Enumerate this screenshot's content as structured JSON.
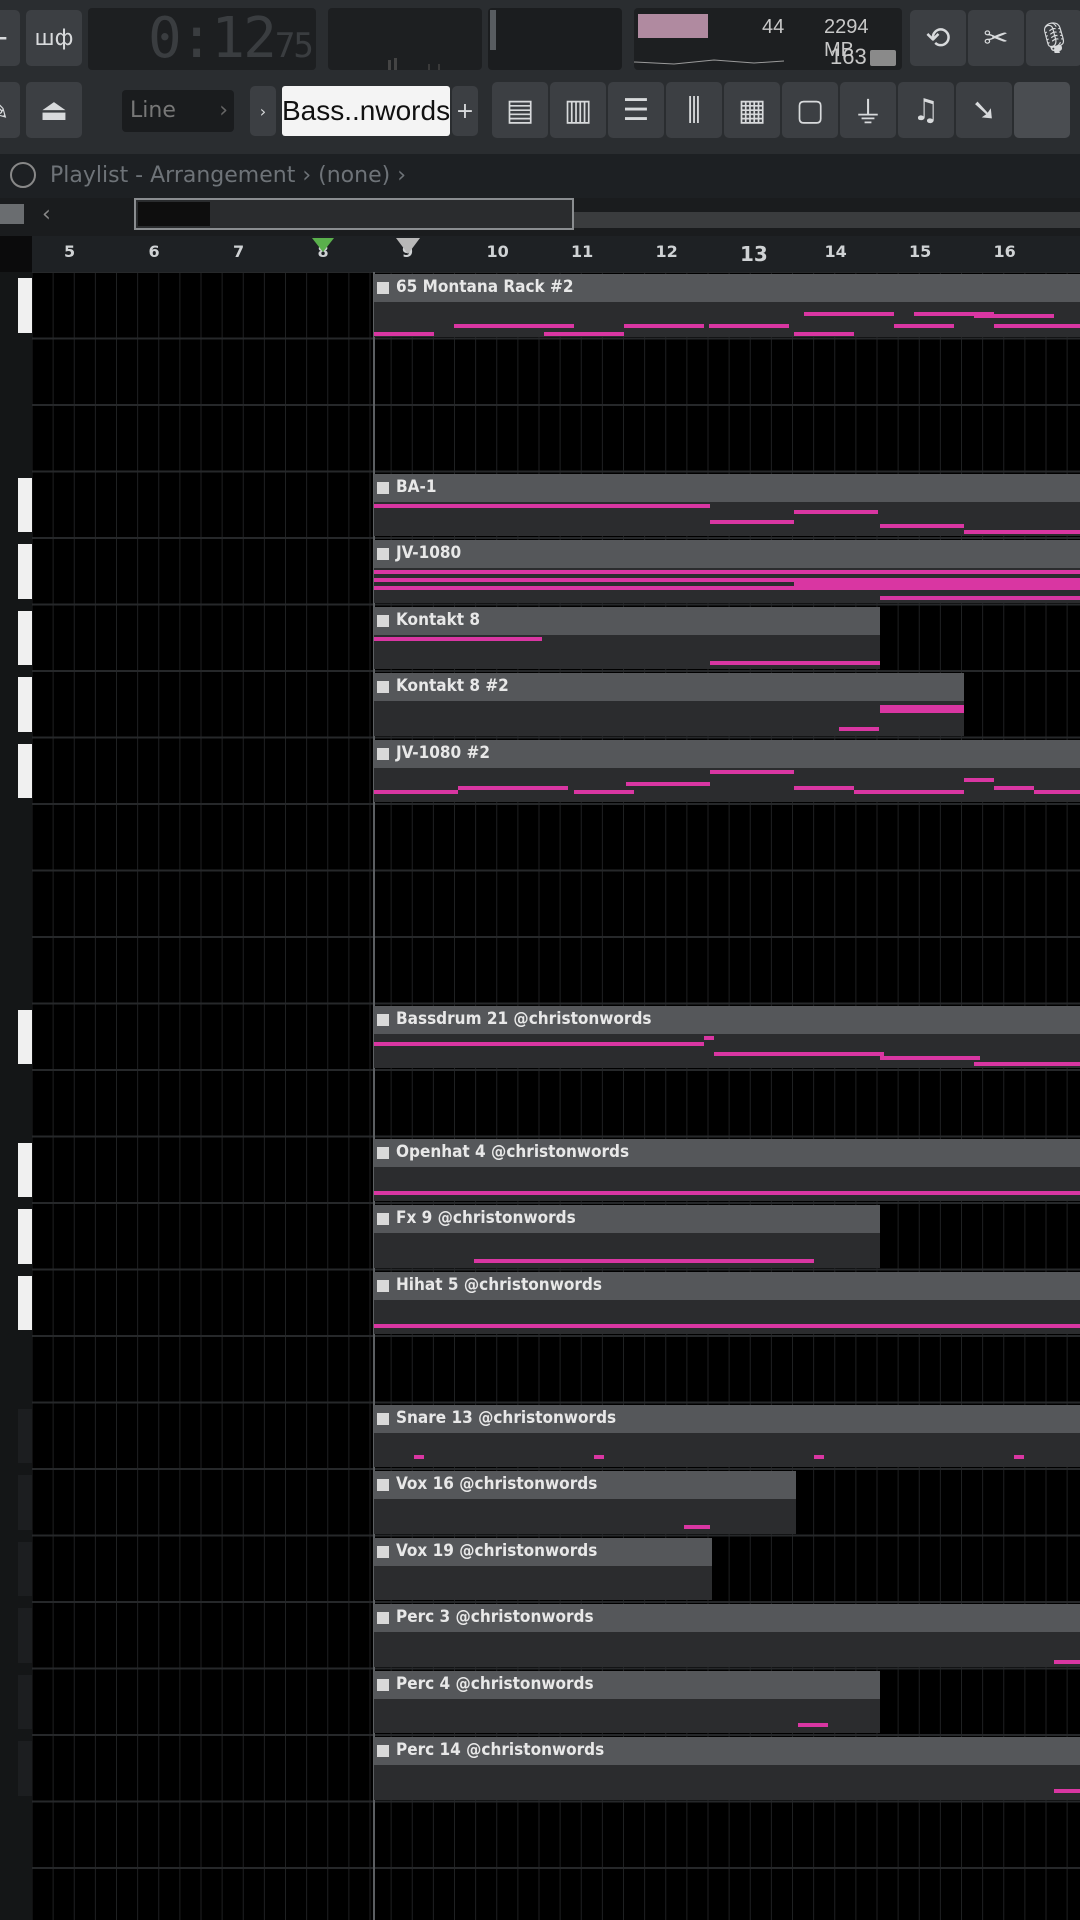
{
  "toolbar": {
    "time_main": "0:12",
    "time_sub": "75",
    "cpu": "44",
    "memory": "2294 MB",
    "polyphony": "163",
    "snap_mode": "Line",
    "pattern": "Bass..nwords",
    "pattern_add": "+",
    "mode_btn": "шф"
  },
  "window": {
    "title": "Playlist - Arrangement",
    "arrow": "›",
    "pattern_sel": "(none)"
  },
  "ruler": {
    "bars": [
      "5",
      "6",
      "7",
      "8",
      "9",
      "10",
      "11",
      "12",
      "13",
      "14",
      "15",
      "16"
    ]
  },
  "colors": {
    "note": "#d936a2",
    "clip_header": "#55575a",
    "clip_body": "#2b2c2e"
  },
  "clips": [
    {
      "name": "65 Montana Rack #2"
    },
    {
      "name": "BA-1"
    },
    {
      "name": "JV-1080"
    },
    {
      "name": "Kontakt 8"
    },
    {
      "name": "Kontakt 8 #2"
    },
    {
      "name": "JV-1080 #2"
    },
    {
      "name": "Bassdrum 21 @christonwords"
    },
    {
      "name": "Openhat 4 @christonwords"
    },
    {
      "name": "Fx 9 @christonwords"
    },
    {
      "name": "Hihat 5 @christonwords"
    },
    {
      "name": "Snare 13 @christonwords"
    },
    {
      "name": "Vox 16 @christonwords"
    },
    {
      "name": "Vox 19 @christonwords"
    },
    {
      "name": "Perc 3 @christonwords"
    },
    {
      "name": "Perc 4 @christonwords"
    },
    {
      "name": "Perc 14 @christonwords"
    }
  ]
}
